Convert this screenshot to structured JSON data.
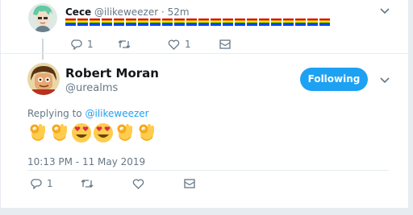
{
  "reply_tweet": {
    "author_name": "Cece",
    "author_handle": "@ilikeweezer",
    "separator": "·",
    "time": "52m",
    "flag_count": 22,
    "flag_colors": [
      "#e40303",
      "#ff8c00",
      "#ffed00",
      "#008026",
      "#004dff",
      "#750787"
    ],
    "actions": {
      "reply_count": "1",
      "retweet_count": "",
      "like_count": "1"
    }
  },
  "main_tweet": {
    "author_name": "Robert Moran",
    "author_handle": "@urealms",
    "follow_label": "Following",
    "replying_prefix": "Replying to",
    "replying_to": "@ilikeweezer",
    "emojis": [
      "ok-hand",
      "ok-hand",
      "heart-eyes",
      "heart-eyes",
      "ok-hand",
      "ok-hand"
    ],
    "timestamp": "10:13 PM - 11 May 2019",
    "actions": {
      "reply_count": "1"
    }
  },
  "colors": {
    "accent": "#1da1f2",
    "muted": "#657786",
    "border": "#e6ecf0"
  },
  "icons": [
    "reply-icon",
    "retweet-icon",
    "like-icon",
    "message-icon",
    "chevron-down-icon"
  ]
}
